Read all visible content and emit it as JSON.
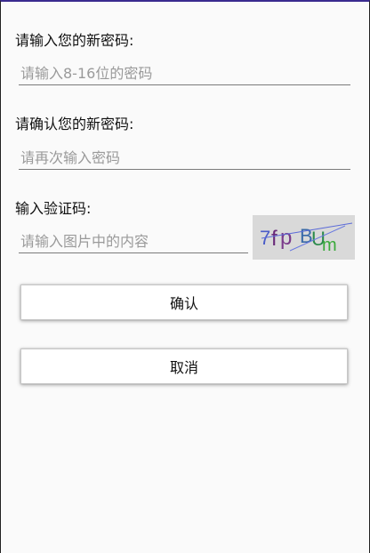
{
  "form": {
    "new_password_label": "请输入您的新密码:",
    "new_password_placeholder": "请输入8-16位的密码",
    "confirm_password_label": "请确认您的新密码:",
    "confirm_password_placeholder": "请再次输入密码",
    "captcha_label": "输入验证码:",
    "captcha_placeholder": "请输入图片中的内容",
    "captcha_text": "7fp BUm"
  },
  "buttons": {
    "confirm_label": "确认",
    "cancel_label": "取消"
  },
  "colors": {
    "top_bar": "#3a2a8f",
    "field_underline": "#7a7a7a",
    "placeholder_text": "#9a9a9a",
    "captcha_background": "#d9d9d9"
  }
}
